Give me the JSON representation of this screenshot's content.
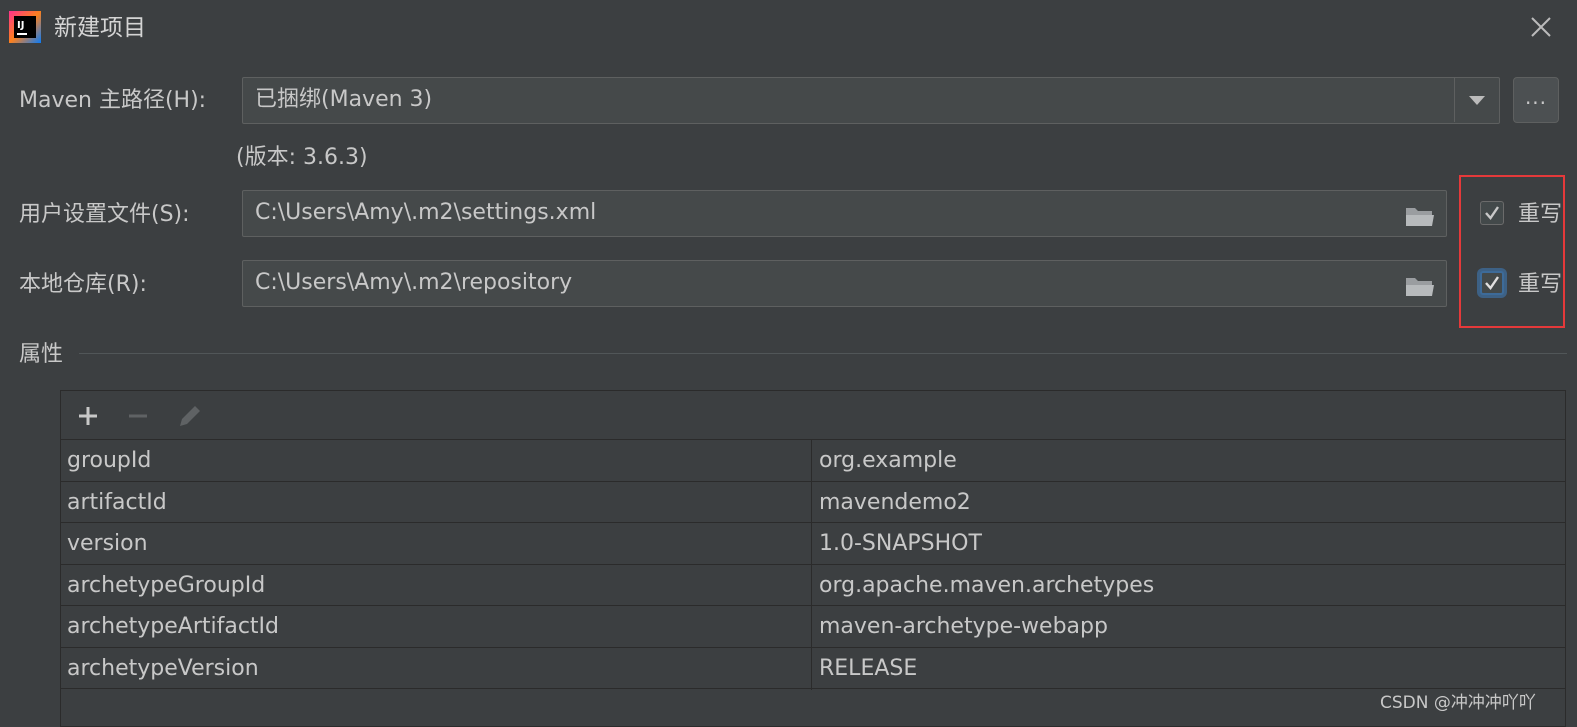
{
  "window": {
    "title": "新建项目"
  },
  "form": {
    "maven_home": {
      "label": "Maven 主路径(H):",
      "value": "已捆绑(Maven 3)",
      "browse_label": "..."
    },
    "version_note": "(版本: 3.6.3)",
    "user_settings": {
      "label": "用户设置文件(S):",
      "value": "C:\\Users\\Amy\\.m2\\settings.xml",
      "override_label": "重写",
      "override_checked": true
    },
    "local_repo": {
      "label": "本地仓库(R):",
      "value": "C:\\Users\\Amy\\.m2\\repository",
      "override_label": "重写",
      "override_checked": true
    }
  },
  "properties": {
    "section_title": "属性",
    "rows": [
      {
        "key": "groupId",
        "value": "org.example"
      },
      {
        "key": "artifactId",
        "value": "mavendemo2"
      },
      {
        "key": "version",
        "value": "1.0-SNAPSHOT"
      },
      {
        "key": "archetypeGroupId",
        "value": "org.apache.maven.archetypes"
      },
      {
        "key": "archetypeArtifactId",
        "value": "maven-archetype-webapp"
      },
      {
        "key": "archetypeVersion",
        "value": "RELEASE"
      }
    ]
  },
  "watermark": "CSDN @冲冲冲吖吖",
  "colors": {
    "background": "#3c3f41",
    "field": "#45494a",
    "highlight_box": "#e5393a",
    "focus": "#3d6b99"
  }
}
